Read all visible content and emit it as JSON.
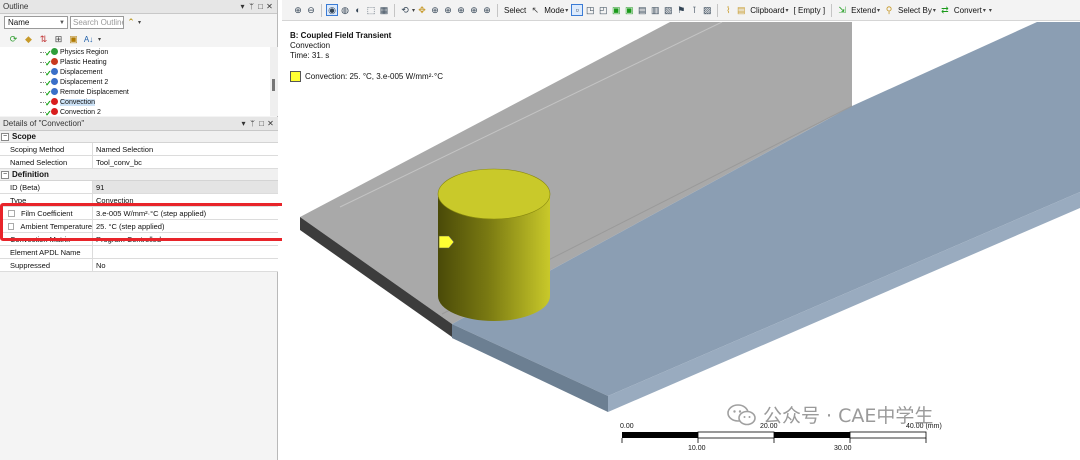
{
  "outline": {
    "title": "Outline",
    "name_select": "Name",
    "search_placeholder": "Search Outline",
    "tree": [
      {
        "label": "Physics Region",
        "glyph_color": "#2e9e3a",
        "selected": false
      },
      {
        "label": "Plastic Heating",
        "glyph_color": "#c8391f",
        "selected": false
      },
      {
        "label": "Displacement",
        "glyph_color": "#3a6fc8",
        "selected": false
      },
      {
        "label": "Displacement 2",
        "glyph_color": "#3a6fc8",
        "selected": false
      },
      {
        "label": "Remote Displacement",
        "glyph_color": "#3a6fc8",
        "selected": false
      },
      {
        "label": "Convection",
        "glyph_color": "#d81e1e",
        "selected": true
      },
      {
        "label": "Convection 2",
        "glyph_color": "#d81e1e",
        "selected": false
      }
    ]
  },
  "details": {
    "title": "Details of \"Convection\"",
    "scope_header": "Scope",
    "scoping_method_label": "Scoping Method",
    "scoping_method_value": "Named Selection",
    "named_selection_label": "Named Selection",
    "named_selection_value": "Tool_conv_bc",
    "definition_header": "Definition",
    "id_label": "ID (Beta)",
    "id_value": "91",
    "type_label": "Type",
    "type_value": "Convection",
    "film_label": "Film Coefficient",
    "film_value": "3.e-005 W/mm²·°C  (step applied)",
    "ambient_label": "Ambient Temperature",
    "ambient_value": "25. °C  (step applied)",
    "conv_matrix_label": "Convection Matrix",
    "conv_matrix_value": "Program Controlled",
    "apdl_label": "Element APDL Name",
    "apdl_value": "",
    "suppressed_label": "Suppressed",
    "suppressed_value": "No"
  },
  "toolbar": {
    "select": "Select",
    "mode": "Mode",
    "clipboard": "Clipboard",
    "empty": "[ Empty ]",
    "extend": "Extend",
    "select_by": "Select By",
    "convert": "Convert"
  },
  "viewport": {
    "title": "B: Coupled Field Transient",
    "subtitle": "Convection",
    "time": "Time: 31. s",
    "legend_label": "Convection: 25. °C, 3.e-005 W/mm²·°C",
    "legend_color": "#ffff33",
    "cylinder_color": "#c9c92a",
    "plate_grey": "#a9a9a9",
    "plate_blue": "#8b9eb3"
  },
  "scale": {
    "t0": "0.00",
    "t20": "20.00",
    "t40": "40.00 (mm)",
    "t10": "10.00",
    "t30": "30.00"
  },
  "watermark": {
    "text": "公众号 · CAE中学生"
  }
}
